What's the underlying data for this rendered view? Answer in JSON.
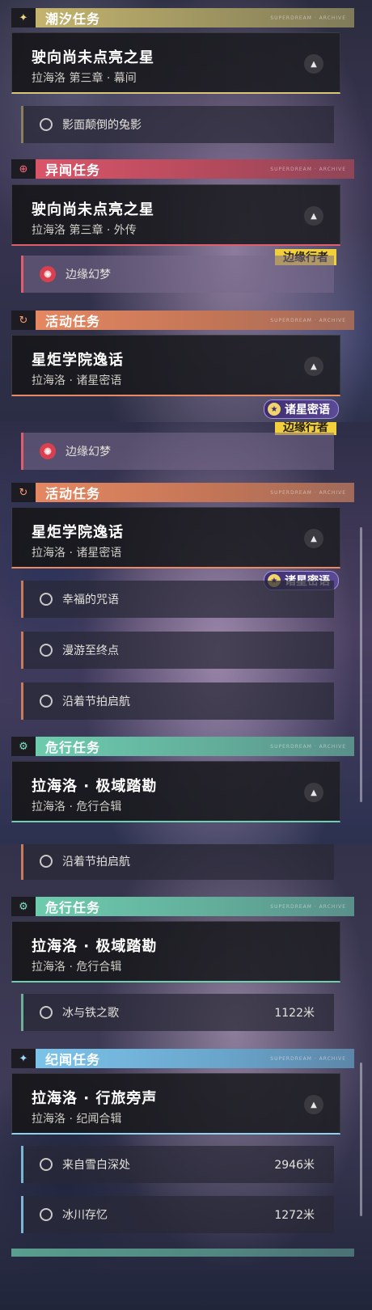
{
  "segment1": {
    "tide": {
      "header": "潮汐任务",
      "title": "驶向尚未点亮之星",
      "subtitle": "拉海洛 第三章 · 幕间",
      "sub": "影面颠倒的兔影"
    },
    "rumor": {
      "header": "异闻任务",
      "title": "驶向尚未点亮之星",
      "subtitle": "拉海洛 第三章 · 外传",
      "tag": "边缘行者",
      "sub": "边缘幻梦"
    },
    "activity": {
      "header": "活动任务",
      "title": "星炬学院逸话",
      "subtitle": "拉海洛 · 诸星密语",
      "tag": "诸星密语"
    }
  },
  "segment2": {
    "rumor_tag": "边缘行者",
    "rumor_sub": "边缘幻梦",
    "activity": {
      "header": "活动任务",
      "title": "星炬学院逸话",
      "subtitle": "拉海洛 · 诸星密语",
      "tag": "诸星密语",
      "subs": [
        "幸福的咒语",
        "漫游至终点",
        "沿着节拍启航"
      ]
    },
    "danger": {
      "header": "危行任务",
      "title": "拉海洛 · 极域踏勘",
      "subtitle": "拉海洛 · 危行合辑"
    }
  },
  "segment3": {
    "activity_sub": "沿着节拍启航",
    "danger": {
      "header": "危行任务",
      "title": "拉海洛 · 极域踏勘",
      "subtitle": "拉海洛 · 危行合辑",
      "sub": "冰与铁之歌",
      "sub_dist": "1122米"
    },
    "chronicle": {
      "header": "纪闻任务",
      "title": "拉海洛 · 行旅旁声",
      "subtitle": "拉海洛 · 纪闻合辑",
      "subs": [
        {
          "label": "来自雪白深处",
          "dist": "2946米"
        },
        {
          "label": "冰川存忆",
          "dist": "1272米"
        }
      ]
    }
  },
  "header_deco": "SUPERDREAM · ARCHIVE",
  "icons": {
    "tide": "sparkle-icon",
    "rumor": "crosshair-icon",
    "activity": "loop-icon",
    "danger": "gear-icon",
    "chronicle": "sparkle-icon",
    "expand": "chevron-up-icon",
    "dream": "dream-emblem-icon",
    "star": "star-emblem-icon"
  }
}
